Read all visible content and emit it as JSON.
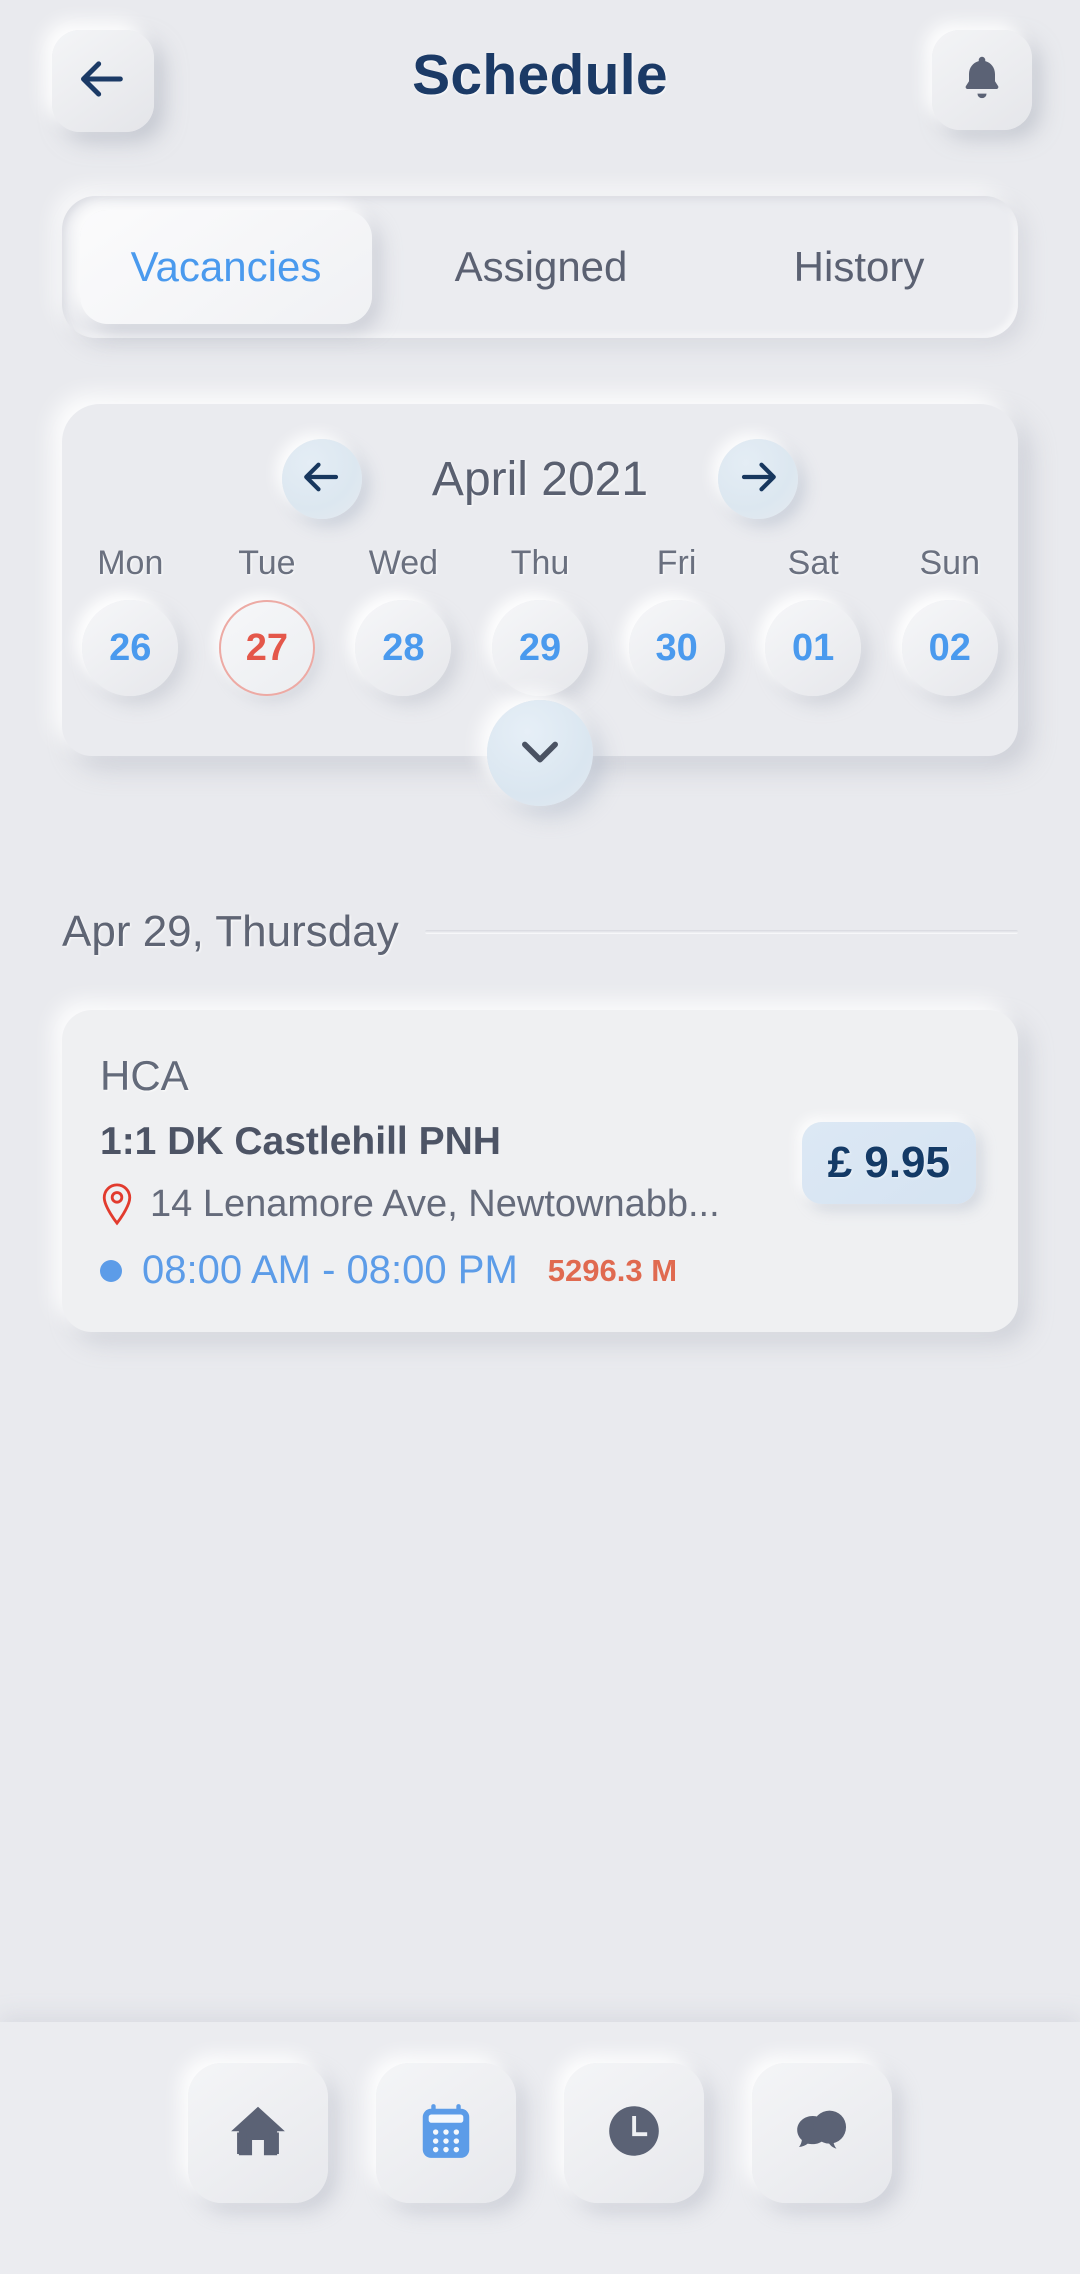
{
  "header": {
    "title": "Schedule",
    "back_icon": "arrow-left-icon",
    "notification_icon": "bell-icon"
  },
  "tabs": [
    {
      "label": "Vacancies",
      "active": true
    },
    {
      "label": "Assigned",
      "active": false
    },
    {
      "label": "History",
      "active": false
    }
  ],
  "calendar": {
    "month_label": "April 2021",
    "prev_icon": "arrow-left-icon",
    "next_icon": "arrow-right-icon",
    "expand_icon": "chevron-down-icon",
    "weekdays": [
      "Mon",
      "Tue",
      "Wed",
      "Thu",
      "Fri",
      "Sat",
      "Sun"
    ],
    "dates": [
      {
        "day": "26",
        "today": false
      },
      {
        "day": "27",
        "today": true
      },
      {
        "day": "28",
        "today": false
      },
      {
        "day": "29",
        "today": false
      },
      {
        "day": "30",
        "today": false
      },
      {
        "day": "01",
        "today": false
      },
      {
        "day": "02",
        "today": false
      }
    ]
  },
  "section": {
    "date_label": "Apr 29, Thursday"
  },
  "job": {
    "role": "HCA",
    "title": "1:1 DK Castlehill PNH",
    "address": "14 Lenamore Ave, Newtownabb...",
    "location_icon": "map-pin-icon",
    "time": "08:00 AM - 08:00 PM",
    "distance": "5296.3 M",
    "price": "£ 9.95"
  },
  "bottom_nav": [
    {
      "icon": "home-icon",
      "active": false
    },
    {
      "icon": "calendar-icon",
      "active": true
    },
    {
      "icon": "clock-icon",
      "active": false
    },
    {
      "icon": "chat-icon",
      "active": false
    }
  ],
  "colors": {
    "background": "#e9eaee",
    "accent_blue": "#4a9aee",
    "time_blue": "#5c9ce8",
    "today_red": "#e4574a",
    "distance_red": "#e06a50",
    "title_navy": "#1b3a66",
    "text_gray": "#5f6574",
    "icon_slate": "#5b6275"
  }
}
